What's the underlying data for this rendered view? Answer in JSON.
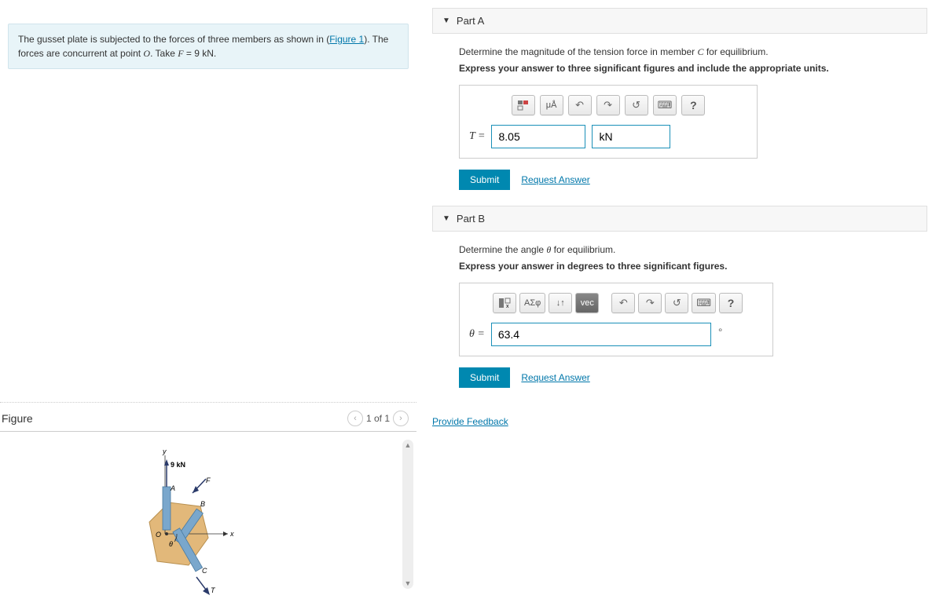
{
  "problem": {
    "text_before_link": "The gusset plate is subjected to the forces of three members as shown in (",
    "link_text": "Figure 1",
    "text_after_link": "). The forces are concurrent at point ",
    "point": "O",
    "text_after_point": ". Take ",
    "eq_var": "F",
    "eq_value": " = 9 kN."
  },
  "figure": {
    "title": "Figure",
    "page": "1 of 1",
    "labels": {
      "y": "y",
      "x": "x",
      "force": "9 kN",
      "A": "A",
      "B": "B",
      "C": "C",
      "F": "F",
      "T": "T",
      "theta": "θ",
      "O": "O"
    }
  },
  "partA": {
    "title": "Part A",
    "instr": "Determine the magnitude of the tension force in member C for equilibrium.",
    "bold": "Express your answer to three significant figures and include the appropriate units.",
    "toolbar": {
      "units": "μÅ",
      "help": "?"
    },
    "var_label": "T = ",
    "value": "8.05",
    "unit": "kN",
    "submit": "Submit",
    "request": "Request Answer"
  },
  "partB": {
    "title": "Part B",
    "instr": "Determine the angle θ for equilibrium.",
    "bold": "Express your answer in degrees to three significant figures.",
    "toolbar": {
      "sigma": "ΑΣφ",
      "vec": "vec",
      "arrows": "↓↑",
      "help": "?"
    },
    "var_label": "θ = ",
    "value": "63.4",
    "unit_suffix": "∘",
    "submit": "Submit",
    "request": "Request Answer"
  },
  "feedback": {
    "label": "Provide Feedback"
  }
}
